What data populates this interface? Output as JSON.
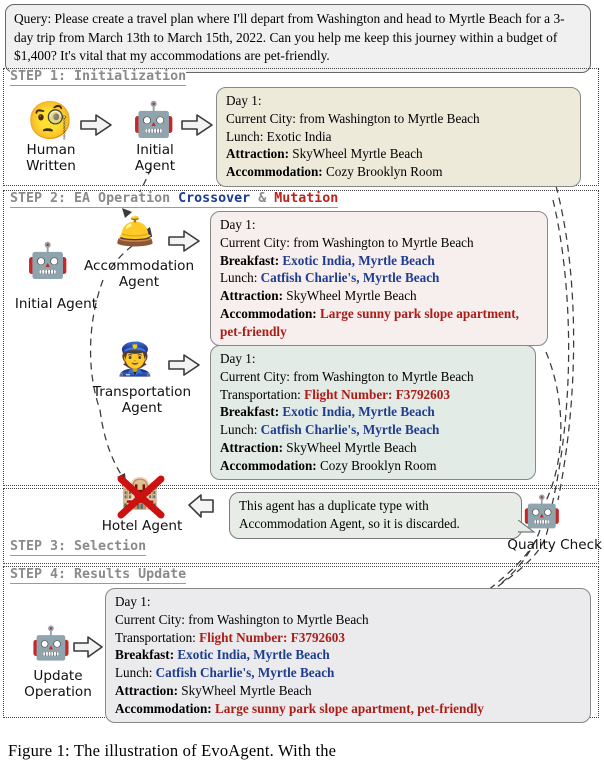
{
  "query": {
    "prefix": "Query:",
    "text": "Query: Please create a travel plan where I'll depart from Washington and head to Myrtle Beach for a 3-day trip from March 13th to March 15th, 2022. Can you help me keep this journey within a budget of $1,400? It's vital that my accommodations are pet-friendly."
  },
  "steps": {
    "step1": {
      "title": "STEP 1: Initialization"
    },
    "step2": {
      "title_prefix": "STEP 2: EA Operation ",
      "crossover": "Crossover",
      "amp": " & ",
      "mutation": "Mutation"
    },
    "step3": {
      "title": "STEP 3: Selection"
    },
    "step4": {
      "title": "STEP 4: Results Update"
    }
  },
  "labels": {
    "human_written": "Human\nWritten",
    "initial_agent_1": "Initial\nAgent",
    "initial_agent_2": "Initial Agent",
    "accommodation_agent": "Accommodation\nAgent",
    "transportation_agent": "Transportation\nAgent",
    "hotel_agent": "Hotel Agent",
    "quality_check": "Quality Check",
    "update_operation": "Update\nOperation"
  },
  "icons": {
    "human": "face-with-monocle-icon",
    "initial_agent": "robot-icon",
    "accommodation_agent": "hotel-worker-icon",
    "transportation_agent": "police-officer-transport-icon",
    "hotel_agent": "hotel-agent-icon",
    "quality_check": "robot-icon",
    "update_operation": "robot-icon",
    "discard": "red-cross-icon",
    "arrow": "block-arrow-right-icon",
    "cursor": "cursor-arrow-icon"
  },
  "cards": {
    "initial_plan": {
      "bg": "#edeada",
      "lines": [
        {
          "label": "Day 1:",
          "value": "",
          "label_bold": false,
          "value_color": "black"
        },
        {
          "label": "Current City:",
          "value": " from Washington to Myrtle Beach",
          "label_bold": false,
          "value_color": "black"
        },
        {
          "label": "Lunch:",
          "value": " Exotic India",
          "label_bold": false,
          "value_color": "black"
        },
        {
          "label": "Attraction:",
          "value": " SkyWheel Myrtle Beach",
          "label_bold": true,
          "value_color": "black"
        },
        {
          "label": "Accommodation:",
          "value": " Cozy Brooklyn Room",
          "label_bold": true,
          "value_color": "black"
        }
      ]
    },
    "accommodation_plan": {
      "bg": "#f7eeee",
      "lines": [
        {
          "label": "Day 1:",
          "value": "",
          "label_bold": false,
          "value_color": "black"
        },
        {
          "label": "Current City:",
          "value": " from Washington to Myrtle Beach",
          "label_bold": false,
          "value_color": "black"
        },
        {
          "label": "Breakfast:",
          "value": " Exotic India, Myrtle Beach",
          "label_bold": true,
          "value_color": "blue"
        },
        {
          "label": "Lunch:",
          "value": " Catfish Charlie's, Myrtle Beach",
          "label_bold": false,
          "value_color": "blue"
        },
        {
          "label": "Attraction:",
          "value": " SkyWheel Myrtle Beach",
          "label_bold": true,
          "value_color": "black"
        },
        {
          "label": "Accommodation:",
          "value": " Large sunny park slope apartment, pet-friendly",
          "label_bold": true,
          "value_color": "red",
          "wrap": true
        }
      ]
    },
    "transportation_plan": {
      "bg": "#e3ebe6",
      "lines": [
        {
          "label": "Day 1:",
          "value": "",
          "label_bold": false,
          "value_color": "black"
        },
        {
          "label": "Current City:",
          "value": " from Washington to Myrtle Beach",
          "label_bold": false,
          "value_color": "black"
        },
        {
          "label": "Transportation:",
          "value": " Flight Number: F3792603",
          "label_bold": false,
          "value_color": "red"
        },
        {
          "label": "Breakfast:",
          "value": " Exotic India, Myrtle Beach",
          "label_bold": true,
          "value_color": "blue"
        },
        {
          "label": "Lunch:",
          "value": " Catfish Charlie's, Myrtle Beach",
          "label_bold": false,
          "value_color": "blue"
        },
        {
          "label": "Attraction:",
          "value": " SkyWheel Myrtle Beach",
          "label_bold": true,
          "value_color": "black"
        },
        {
          "label": "Accommodation:",
          "value": " Cozy Brooklyn Room",
          "label_bold": true,
          "value_color": "black"
        }
      ]
    },
    "final_plan": {
      "bg": "#ebebee",
      "lines": [
        {
          "label": "Day 1:",
          "value": "",
          "label_bold": false,
          "value_color": "black"
        },
        {
          "label": "Current City:",
          "value": " from Washington to Myrtle Beach",
          "label_bold": false,
          "value_color": "black"
        },
        {
          "label": "Transportation:",
          "value": " Flight Number: F3792603",
          "label_bold": false,
          "value_color": "red"
        },
        {
          "label": "Breakfast:",
          "value": " Exotic India, Myrtle Beach",
          "label_bold": true,
          "value_color": "blue"
        },
        {
          "label": "Lunch:",
          "value": " Catfish Charlie's, Myrtle Beach",
          "label_bold": false,
          "value_color": "blue"
        },
        {
          "label": "Attraction:",
          "value": " SkyWheel Myrtle Beach",
          "label_bold": true,
          "value_color": "black"
        },
        {
          "label": "Accommodation:",
          "value": " Large sunny park slope apartment, pet-friendly",
          "label_bold": true,
          "value_color": "red"
        }
      ]
    }
  },
  "bubble": {
    "line1": "This agent has a duplicate type with",
    "line2": "Accommodation Agent, so it is discarded."
  },
  "caption": "Figure 1:   The illustration of EvoAgent.   With the",
  "colors": {
    "blue_value": "#1f3d8f",
    "red_value": "#ad1b15",
    "step_title_gray": "#8a8a8a",
    "crossover_blue": "#1a3a93",
    "mutation_red": "#c0211c"
  }
}
